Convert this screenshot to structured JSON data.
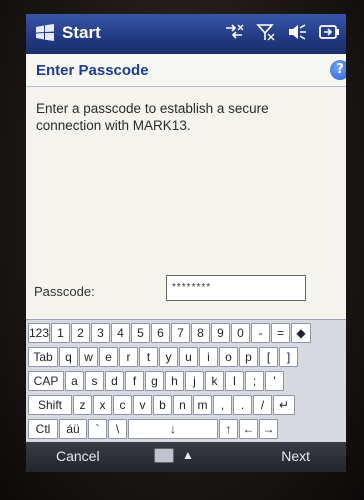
{
  "taskbar": {
    "start_label": "Start"
  },
  "dialog": {
    "title": "Enter Passcode",
    "message": "Enter a passcode to establish a secure connection with MARK13.",
    "passcode_label": "Passcode:",
    "passcode_value": "********"
  },
  "keyboard": {
    "row1": [
      "123",
      "1",
      "2",
      "3",
      "4",
      "5",
      "6",
      "7",
      "8",
      "9",
      "0",
      "-",
      "=",
      "◆"
    ],
    "row2": [
      "Tab",
      "q",
      "w",
      "e",
      "r",
      "t",
      "y",
      "u",
      "i",
      "o",
      "p",
      "[",
      "]"
    ],
    "row3": [
      "CAP",
      "a",
      "s",
      "d",
      "f",
      "g",
      "h",
      "j",
      "k",
      "l",
      ";",
      "'"
    ],
    "row4": [
      "Shift",
      "z",
      "x",
      "c",
      "v",
      "b",
      "n",
      "m",
      ",",
      ".",
      "/",
      "↵"
    ],
    "row5": [
      "Ctl",
      "áü",
      "`",
      "\\",
      "↓",
      "↑",
      "←",
      "→"
    ]
  },
  "softkeys": {
    "left": "Cancel",
    "right": "Next"
  },
  "colors": {
    "titlebar": "#243c86",
    "dialog_title": "#1e3c96"
  }
}
